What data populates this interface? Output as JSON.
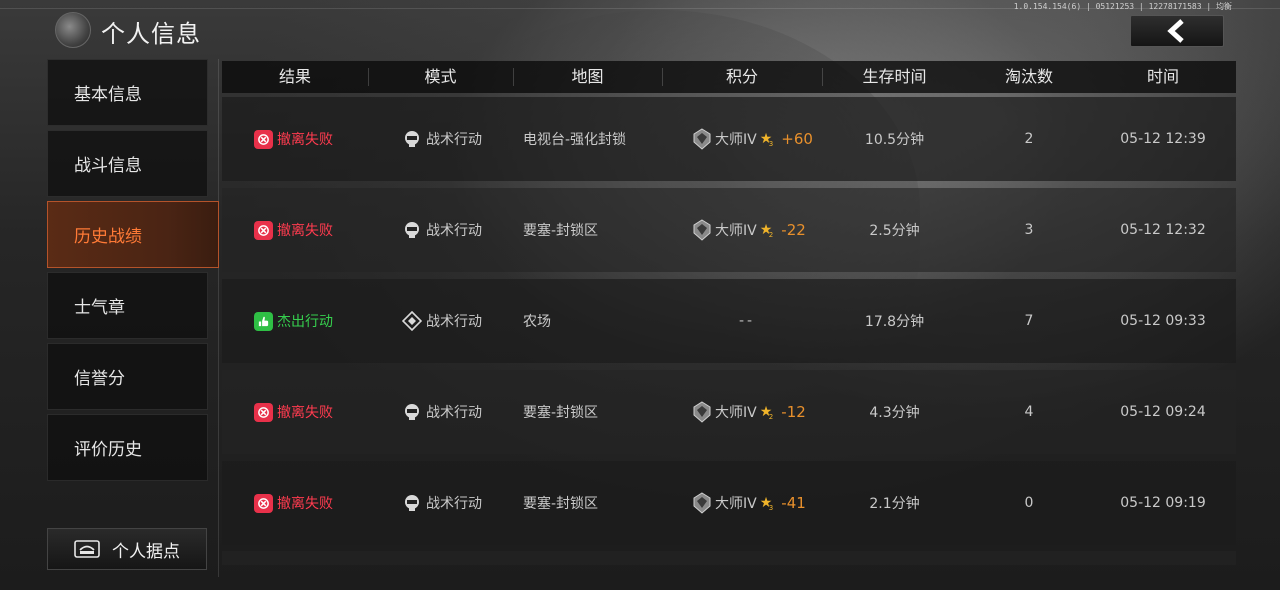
{
  "header": {
    "title": "个人信息",
    "version_text": "1.0.154.154(6) | 05121253 | 12278171583 | 均衡"
  },
  "sidebar": {
    "items": [
      {
        "label": "基本信息",
        "active": false
      },
      {
        "label": "战斗信息",
        "active": false
      },
      {
        "label": "历史战绩",
        "active": true
      },
      {
        "label": "士气章",
        "active": false
      },
      {
        "label": "信誉分",
        "active": false
      },
      {
        "label": "评价历史",
        "active": false
      }
    ],
    "base_button": "个人据点"
  },
  "table": {
    "headers": [
      "结果",
      "模式",
      "地图",
      "积分",
      "生存时间",
      "淘汰数",
      "时间"
    ],
    "rows": [
      {
        "result": "撤离失败",
        "result_type": "fail",
        "mode": "战术行动",
        "map": "电视台-强化封锁",
        "rank": "大师IV",
        "star_level": "3",
        "score_delta": "+60",
        "survival": "10.5分钟",
        "kills": "2",
        "time": "05-12 12:39"
      },
      {
        "result": "撤离失败",
        "result_type": "fail",
        "mode": "战术行动",
        "map": "要塞-封锁区",
        "rank": "大师IV",
        "star_level": "2",
        "score_delta": "-22",
        "survival": "2.5分钟",
        "kills": "3",
        "time": "05-12 12:32"
      },
      {
        "result": "杰出行动",
        "result_type": "win",
        "mode": "战术行动",
        "map": "农场",
        "rank": "",
        "star_level": "",
        "score_delta": "",
        "score_empty": "--",
        "survival": "17.8分钟",
        "kills": "7",
        "time": "05-12 09:33"
      },
      {
        "result": "撤离失败",
        "result_type": "fail",
        "mode": "战术行动",
        "map": "要塞-封锁区",
        "rank": "大师IV",
        "star_level": "2",
        "score_delta": "-12",
        "survival": "4.3分钟",
        "kills": "4",
        "time": "05-12 09:24"
      },
      {
        "result": "撤离失败",
        "result_type": "fail",
        "mode": "战术行动",
        "map": "要塞-封锁区",
        "rank": "大师IV",
        "star_level": "3",
        "score_delta": "-41",
        "survival": "2.1分钟",
        "kills": "0",
        "time": "05-12 09:19"
      }
    ]
  },
  "colors": {
    "fail": "#ff3b4f",
    "win": "#36d04e",
    "accent": "#ff7a36",
    "delta": "#e8902c",
    "star": "#f0b42a"
  }
}
